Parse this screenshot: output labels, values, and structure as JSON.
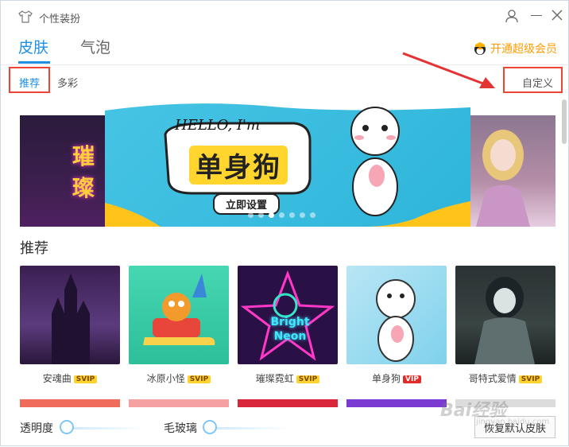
{
  "window": {
    "title": "个性装扮"
  },
  "tabs": [
    {
      "label": "皮肤",
      "active": true
    },
    {
      "label": "气泡",
      "active": false
    }
  ],
  "vip_link": {
    "label": "开通超级会员"
  },
  "subtabs": [
    {
      "label": "推荐",
      "active": true
    },
    {
      "label": "多彩",
      "active": false
    }
  ],
  "custom_link": {
    "label": "自定义"
  },
  "banner": {
    "hello": "HELLO, I'm",
    "title": "单身狗",
    "button_label": "立即设置",
    "left_preview_text": "璀璨",
    "dots_total": 7,
    "dots_active_index": 2
  },
  "section": {
    "title": "推荐"
  },
  "skins": [
    {
      "name": "安魂曲",
      "badge": "SVIP",
      "badge_type": "svip",
      "thumb_text": ""
    },
    {
      "name": "冰原小怪",
      "badge": "SVIP",
      "badge_type": "svip",
      "thumb_text": ""
    },
    {
      "name": "璀璨霓虹",
      "badge": "SVIP",
      "badge_type": "svip",
      "thumb_text": "Bright Neon"
    },
    {
      "name": "单身狗",
      "badge": "VIP",
      "badge_type": "vip",
      "thumb_text": ""
    },
    {
      "name": "哥特式爱情",
      "badge": "SVIP",
      "badge_type": "svip",
      "thumb_text": ""
    }
  ],
  "bottom": {
    "transparency_label": "透明度",
    "transparency_value": 0,
    "frosted_label": "毛玻璃",
    "frosted_value": 0,
    "reset_label": "恢复默认皮肤"
  },
  "watermark": {
    "main": "Bai经验",
    "sub": "jingyan.baidu.com"
  },
  "colors": {
    "accent": "#1f8fe3",
    "vip_orange": "#ff9d00",
    "highlight_red": "#e43333"
  }
}
